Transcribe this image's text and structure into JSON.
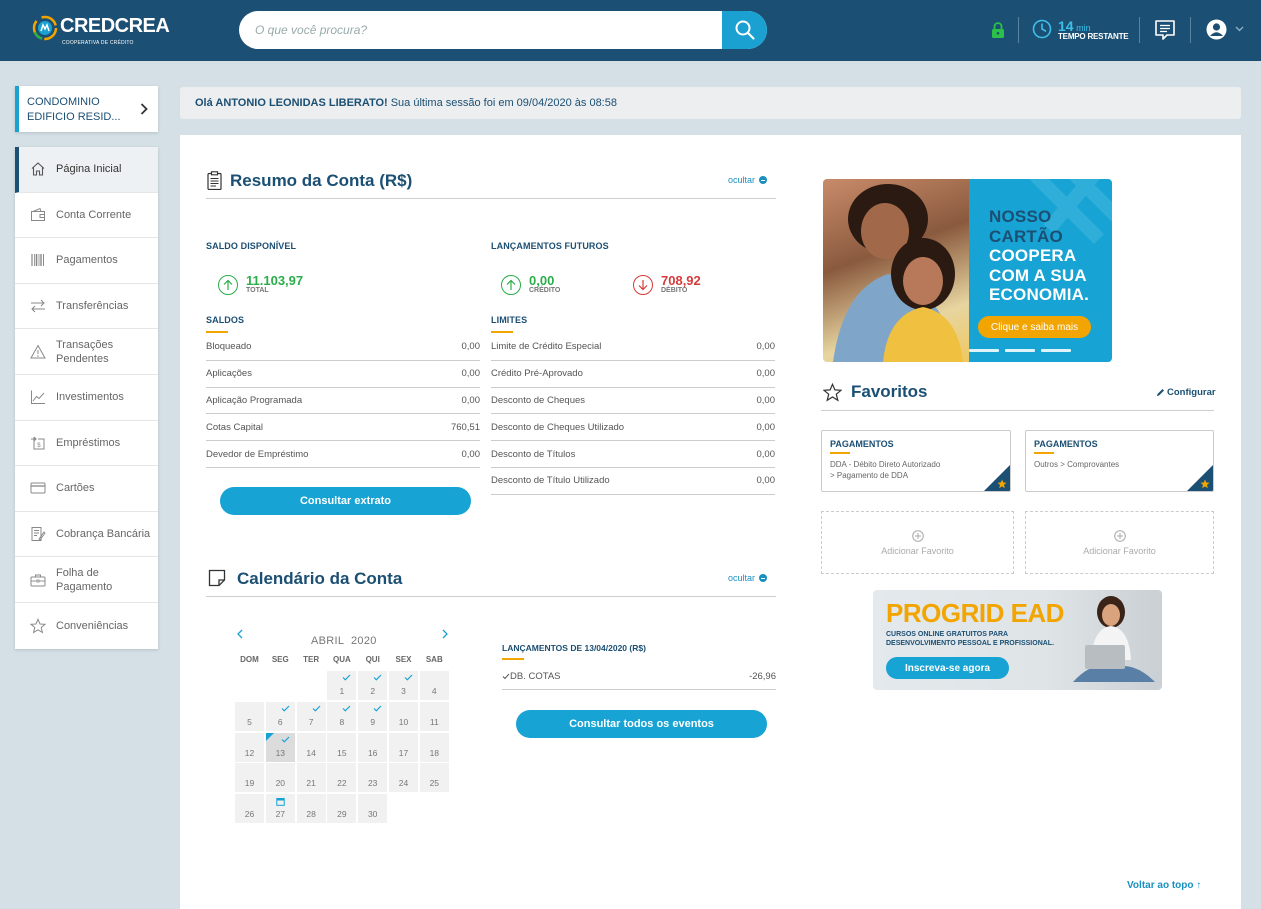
{
  "header": {
    "logo_text": "CREDCREA",
    "logo_sub": "COOPERATIVA DE CRÉDITO",
    "search_placeholder": "O que você procura?",
    "timer_value": "14",
    "timer_unit": "min",
    "timer_label": "TEMPO RESTANTE"
  },
  "sidebar": {
    "account_name": "CONDOMINIO EDIFICIO RESID...",
    "items": [
      {
        "label": "Página Inicial",
        "icon": "home-icon",
        "active": true
      },
      {
        "label": "Conta Corrente",
        "icon": "wallet-icon"
      },
      {
        "label": "Pagamentos",
        "icon": "barcode-icon"
      },
      {
        "label": "Transferências",
        "icon": "transfer-icon"
      },
      {
        "label": "Transações Pendentes",
        "icon": "warning-icon"
      },
      {
        "label": "Investimentos",
        "icon": "chart-icon"
      },
      {
        "label": "Empréstimos",
        "icon": "loan-icon"
      },
      {
        "label": "Cartões",
        "icon": "card-icon"
      },
      {
        "label": "Cobrança Bancária",
        "icon": "invoice-icon"
      },
      {
        "label": "Folha de Pagamento",
        "icon": "briefcase-icon"
      },
      {
        "label": "Conveniências",
        "icon": "star-icon"
      }
    ]
  },
  "greeting": {
    "name": "Olá ANTONIO LEONIDAS LIBERATO!",
    "text": "Sua última sessão foi em 09/04/2020 às 08:58"
  },
  "resumo": {
    "title": "Resumo da Conta (R$)",
    "hide": "ocultar",
    "saldo_label": "SALDO DISPONÍVEL",
    "saldo_value": "11.103,97",
    "saldo_sub": "TOTAL",
    "futuros_label": "LANÇAMENTOS FUTUROS",
    "credito_value": "0,00",
    "credito_sub": "CRÉDITO",
    "debito_value": "708,92",
    "debito_sub": "DÉBITO",
    "saldos_label": "SALDOS",
    "saldos": [
      {
        "label": "Bloqueado",
        "value": "0,00"
      },
      {
        "label": "Aplicações",
        "value": "0,00"
      },
      {
        "label": "Aplicação Programada",
        "value": "0,00"
      },
      {
        "label": "Cotas Capital",
        "value": "760,51"
      },
      {
        "label": "Devedor de Empréstimo",
        "value": "0,00"
      }
    ],
    "limites_label": "LIMITES",
    "limites": [
      {
        "label": "Limite de Crédito Especial",
        "value": "0,00"
      },
      {
        "label": "Crédito Pré-Aprovado",
        "value": "0,00"
      },
      {
        "label": "Desconto de Cheques",
        "value": "0,00"
      },
      {
        "label": "Desconto de Cheques Utilizado",
        "value": "0,00"
      },
      {
        "label": "Desconto de Títulos",
        "value": "0,00"
      },
      {
        "label": "Desconto de Título Utilizado",
        "value": "0,00"
      }
    ],
    "button": "Consultar extrato"
  },
  "calendario": {
    "title": "Calendário da Conta",
    "hide": "ocultar",
    "month": "ABRIL",
    "year": "2020",
    "dow": [
      "DOM",
      "SEG",
      "TER",
      "QUA",
      "QUI",
      "SEX",
      "SAB"
    ],
    "first_weekday": 3,
    "days_in_month": 30,
    "today": 13,
    "checked_days": [
      1,
      2,
      3,
      6,
      7,
      8,
      9,
      13
    ],
    "event_days": [
      27
    ],
    "events_title": "LANÇAMENTOS DE 13/04/2020 (R$)",
    "events": [
      {
        "label": "DB. COTAS",
        "value": "-26,96"
      }
    ],
    "button": "Consultar todos os eventos"
  },
  "promo": {
    "line1": "NOSSO",
    "line2": "CARTÃO",
    "line3": "COOPERA",
    "line4": "COM A SUA",
    "line5": "ECONOMIA.",
    "cta": "Clique e saiba mais"
  },
  "favoritos": {
    "title": "Favoritos",
    "config": "Configurar",
    "cards": [
      {
        "title": "PAGAMENTOS",
        "line1": "DDA - Débito Direto Autorizado",
        "line2": "> Pagamento de DDA"
      },
      {
        "title": "PAGAMENTOS",
        "line1": "Outros > Comprovantes",
        "line2": ""
      }
    ],
    "add_label": "Adicionar Favorito"
  },
  "ead": {
    "title": "PROGRID EAD",
    "sub1": "CURSOS ONLINE GRATUITOS PARA",
    "sub2": "DESENVOLVIMENTO PESSOAL E PROFISSIONAL.",
    "button": "Inscreva-se agora"
  },
  "footer": {
    "back_top": "Voltar ao topo ↑"
  },
  "colors": {
    "header": "#1b4f73",
    "accent": "#17a3d3",
    "positive": "#2bae4a",
    "negative": "#d63b3b",
    "highlight": "#f2a500"
  }
}
